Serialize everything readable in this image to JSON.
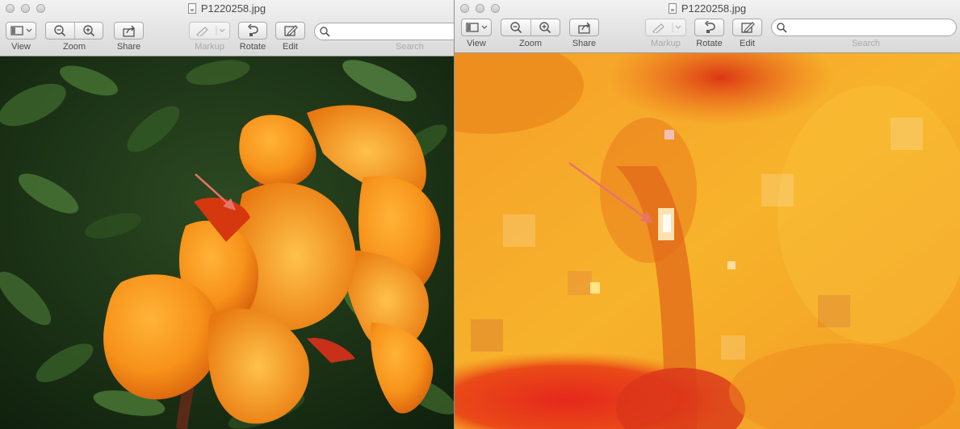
{
  "window_left": {
    "title": "P1220258.jpg",
    "toolbar": {
      "view_label": "View",
      "zoom_label": "Zoom",
      "share_label": "Share",
      "markup_label": "Markup",
      "rotate_label": "Rotate",
      "edit_label": "Edit",
      "search_label": "Search",
      "search_value": ""
    }
  },
  "window_right": {
    "title": "P1220258.jpg",
    "toolbar": {
      "view_label": "View",
      "zoom_label": "Zoom",
      "share_label": "Share",
      "markup_label": "Markup",
      "rotate_label": "Rotate",
      "edit_label": "Edit",
      "search_label": "Search",
      "search_value": ""
    }
  },
  "icons": [
    "sidebar-view-icon",
    "zoom-out-icon",
    "zoom-in-icon",
    "share-icon",
    "markup-pen-icon",
    "rotate-icon",
    "edit-icon",
    "search-icon"
  ],
  "colors": {
    "annotation_arrow": "#e8736a",
    "petal_orange": "#f39a1a",
    "foliage_dark": "#1f3a1a"
  }
}
